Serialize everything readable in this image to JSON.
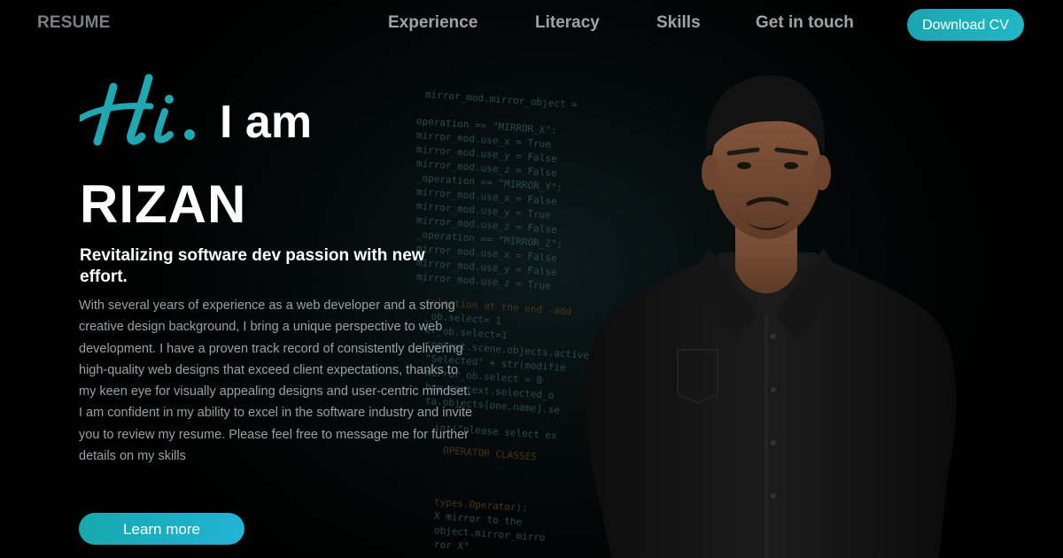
{
  "nav": {
    "logo": "RESUME",
    "links": [
      "Experience",
      "Literacy",
      "Skills",
      "Get in touch"
    ],
    "download_label": "Download CV"
  },
  "hero": {
    "greeting_script": "Hi.",
    "greeting_text": "I am",
    "name": "RIZAN",
    "tagline": "Revitalizing software dev passion with new effort.",
    "bio": "With several years of experience as a web developer and a strong creative design background, I bring a unique perspective to web development. I have a proven track record of consistently delivering high-quality web designs that exceed client expectations, thanks to my keen eye for visually appealing designs and user-centric mindset. I am confident in my ability to excel in the software industry and invite you to review my resume. Please feel free to message me for further details on my skills",
    "cta_label": "Learn more"
  },
  "colors": {
    "accent": "#21b7c6",
    "background": "#000000",
    "nav_text": "#9ea3a7",
    "bio_text": "#9aa0a5"
  }
}
